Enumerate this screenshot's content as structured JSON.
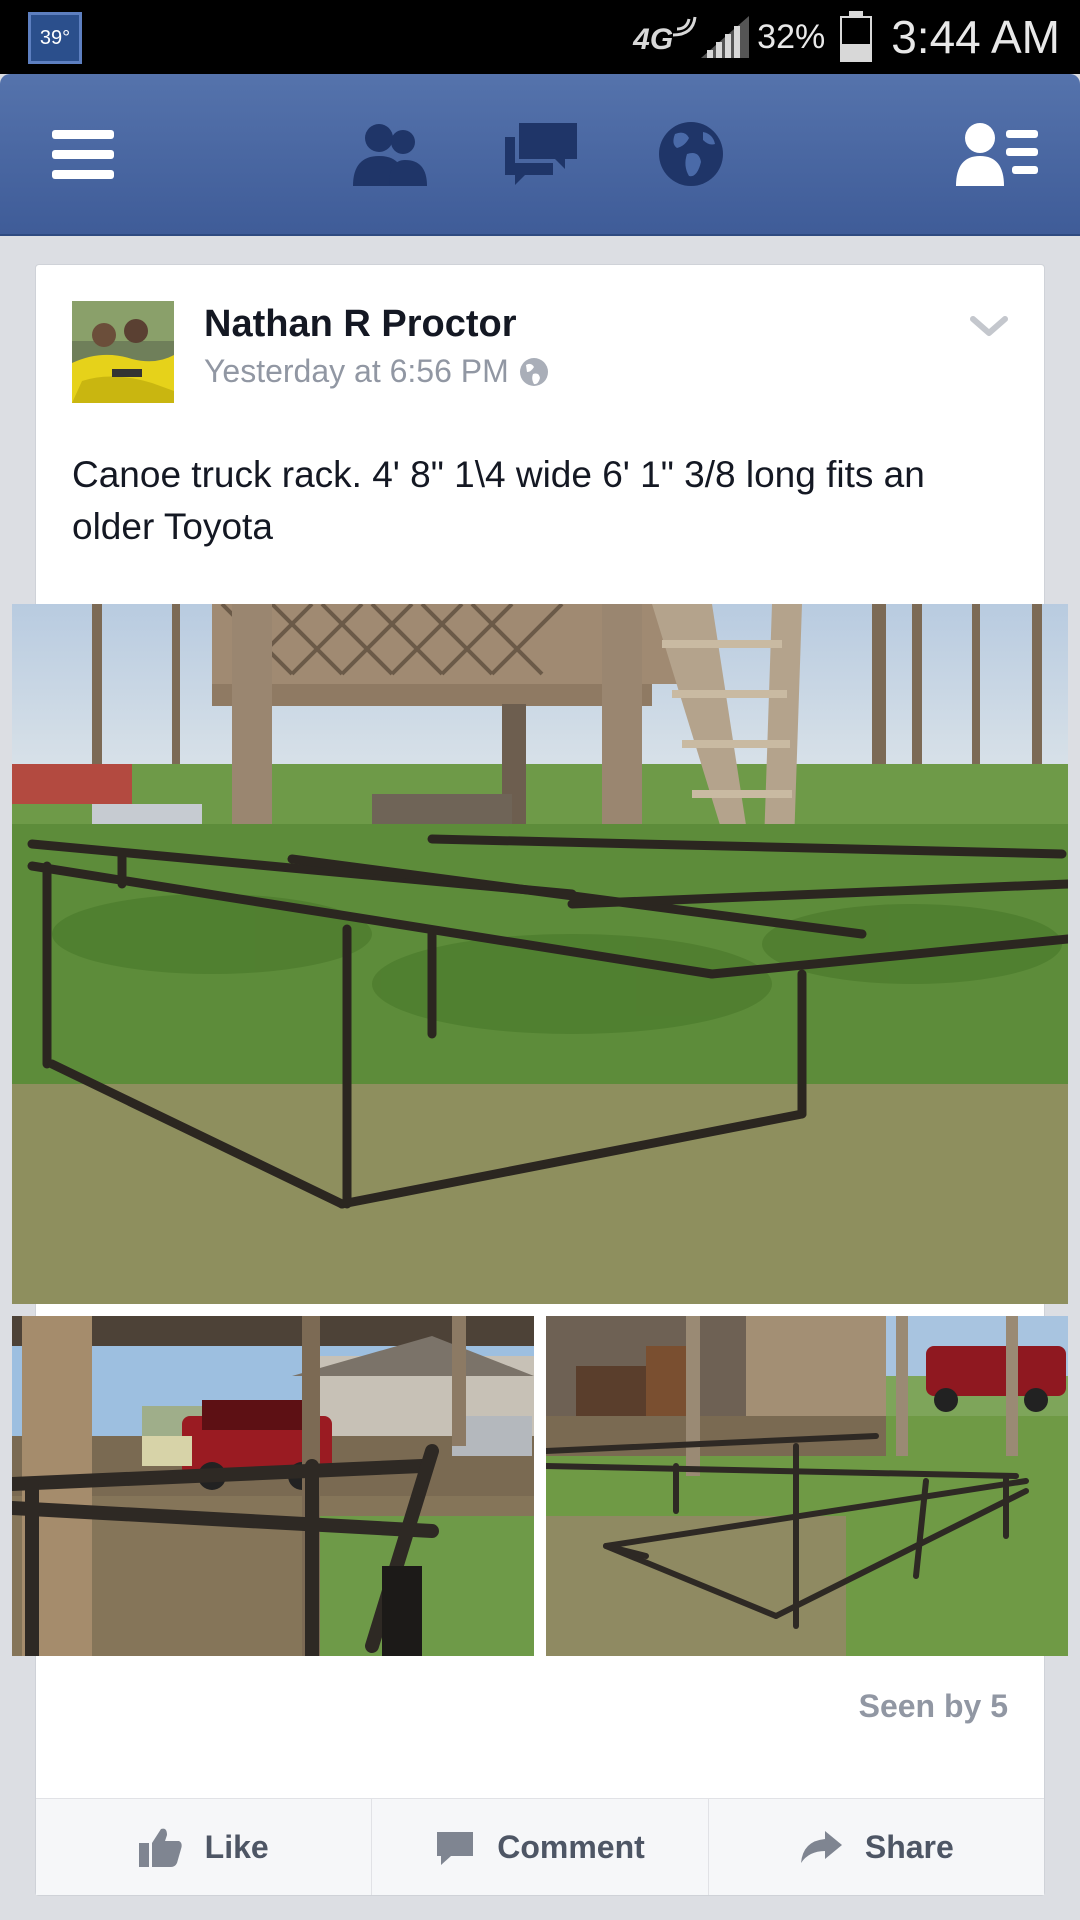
{
  "status_bar": {
    "temperature": "39°",
    "network": "4G",
    "battery_percent": "32%",
    "time": "3:44 AM"
  },
  "nav": {
    "items": [
      "menu-icon",
      "friends-icon",
      "messages-icon",
      "notifications-globe-icon",
      "profile-icon"
    ]
  },
  "post": {
    "author": "Nathan R Proctor",
    "timestamp": "Yesterday at 6:56 PM",
    "privacy": "public",
    "text": "Canoe truck rack. 4' 8\" 1\\4 wide 6' 1\" 3/8 long fits an older Toyota",
    "photos": [
      "main-photo",
      "bottom-left-photo",
      "bottom-right-photo"
    ],
    "seen_by": "Seen by 5"
  },
  "actions": {
    "like": "Like",
    "comment": "Comment",
    "share": "Share"
  }
}
